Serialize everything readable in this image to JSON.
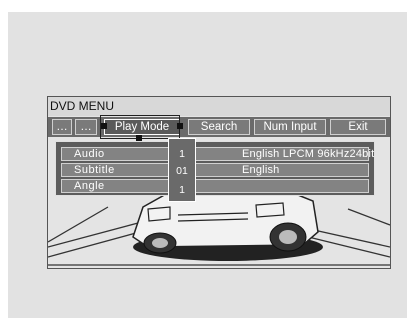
{
  "window": {
    "title": "DVD MENU"
  },
  "menu": {
    "items": [
      {
        "label": "…"
      },
      {
        "label": "…"
      },
      {
        "label": "Play Mode"
      },
      {
        "label": "Search"
      },
      {
        "label": "Num Input"
      },
      {
        "label": "Exit"
      }
    ],
    "selected": "Play Mode"
  },
  "settings": {
    "rows": [
      {
        "label": "Audio",
        "number": "1",
        "value": "English  LPCM  96kHz24bit"
      },
      {
        "label": "Subtitle",
        "number": "01",
        "value": "English"
      },
      {
        "label": "Angle",
        "number": "1",
        "value": ""
      }
    ]
  }
}
